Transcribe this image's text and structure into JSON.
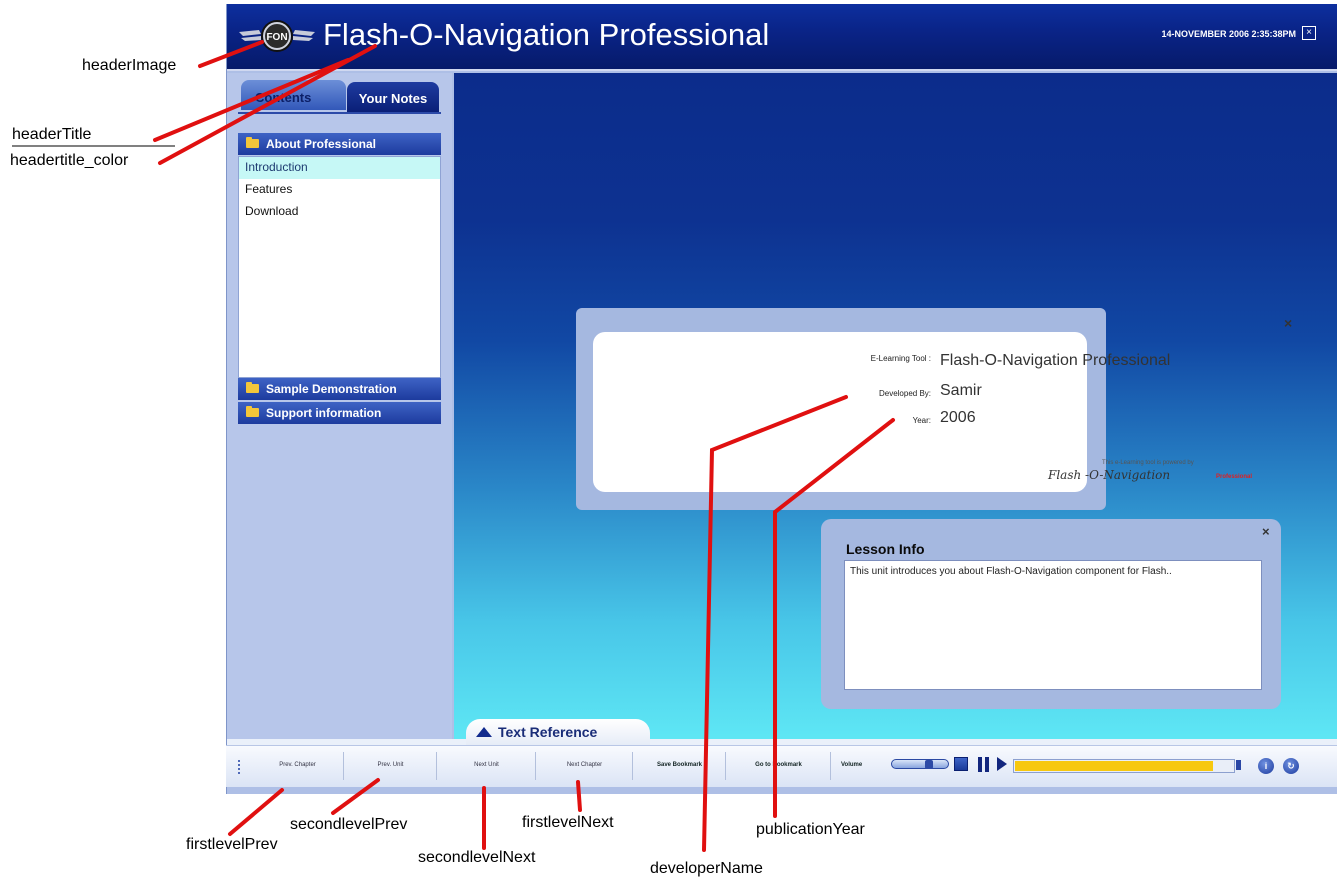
{
  "header": {
    "title": "Flash-O-Navigation Professional",
    "logo_text": "FON",
    "datetime": "14-NOVEMBER 2006 2:35:38PM",
    "close_glyph": "×"
  },
  "sidebar": {
    "tabs": [
      {
        "label": "Contents"
      },
      {
        "label": "Your Notes"
      }
    ],
    "folders": [
      {
        "label": "About Professional",
        "items": [
          "Introduction",
          "Features",
          "Download"
        ],
        "selected_index": 0
      },
      {
        "label": "Sample Demonstration"
      },
      {
        "label": "Support information"
      }
    ]
  },
  "about": {
    "close_glyph": "×",
    "rows": [
      {
        "label": "E-Learning Tool :",
        "value": "Flash-O-Navigation Professional"
      },
      {
        "label": "Developed By:",
        "value": "Samir"
      },
      {
        "label": "Year:",
        "value": "2006"
      }
    ],
    "powered_line": "This e-Learning tool is powered by",
    "powered_brand": "Flash -O-Navigation",
    "powered_sub": "Professional"
  },
  "lesson_info": {
    "close_glyph": "×",
    "title": "Lesson Info",
    "body": "This unit introduces you about Flash-O-Navigation component for Flash.."
  },
  "text_reference": {
    "label": "Text Reference"
  },
  "toolbar": {
    "prev_chapter": "Prev. Chapter",
    "prev_unit": "Prev. Unit",
    "next_unit": "Next Unit",
    "next_chapter": "Next Chapter",
    "save_bookmark": "Save Bookmark",
    "go_bookmark": "Go to Bookmark",
    "volume": "Volume",
    "volume_level": 0.7,
    "progress": 0.91,
    "info_glyph": "i",
    "exit_glyph": "↻"
  },
  "callouts": {
    "header_image": "headerImage",
    "header_title": "headerTitle",
    "header_title_color": "headertitle_color",
    "first_level_prev": "firstlevelPrev",
    "second_level_prev": "secondlevelPrev",
    "second_level_next": "secondlevelNext",
    "first_level_next": "firstlevelNext",
    "developer_name": "developerName",
    "publication_year": "publicationYear"
  },
  "colors": {
    "header_bg": "#0a2488",
    "sidebar_bg": "#b7c6ea",
    "callout_line": "#e01010",
    "progress_fill": "#f7c80f"
  }
}
